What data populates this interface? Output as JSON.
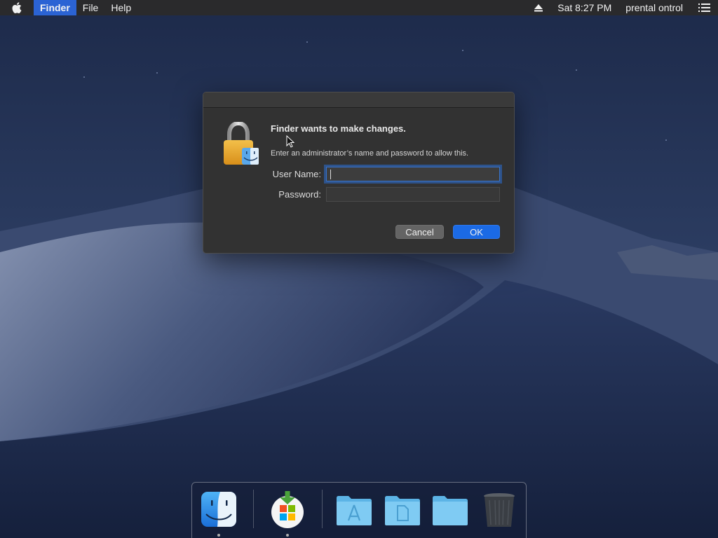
{
  "menubar": {
    "apple_icon": "apple-logo-icon",
    "items": [
      {
        "label": "Finder",
        "active": true
      },
      {
        "label": "File"
      },
      {
        "label": "Help"
      }
    ],
    "clock": "Sat 8:27 PM",
    "user": "prental ontrol",
    "eject_icon": "eject-icon",
    "list_icon": "notification-center-icon"
  },
  "dialog": {
    "title": "Finder wants to make changes.",
    "message": "Enter an administrator’s name and password to allow this.",
    "username_label": "User Name:",
    "username_value": "",
    "password_label": "Password:",
    "password_value": "",
    "cancel_label": "Cancel",
    "ok_label": "OK",
    "icon": "lock-finder-icon"
  },
  "dock": {
    "items": [
      {
        "name": "finder-icon",
        "running": true
      },
      {
        "name": "installer-download-icon",
        "running": true
      },
      {
        "name": "applications-folder-icon",
        "running": false
      },
      {
        "name": "documents-folder-icon",
        "running": false
      },
      {
        "name": "downloads-folder-icon",
        "running": false
      },
      {
        "name": "trash-icon",
        "running": false
      }
    ]
  },
  "colors": {
    "accent": "#1b6ae5",
    "menubar_active": "#2b63d4",
    "dialog_bg": "#323232"
  }
}
